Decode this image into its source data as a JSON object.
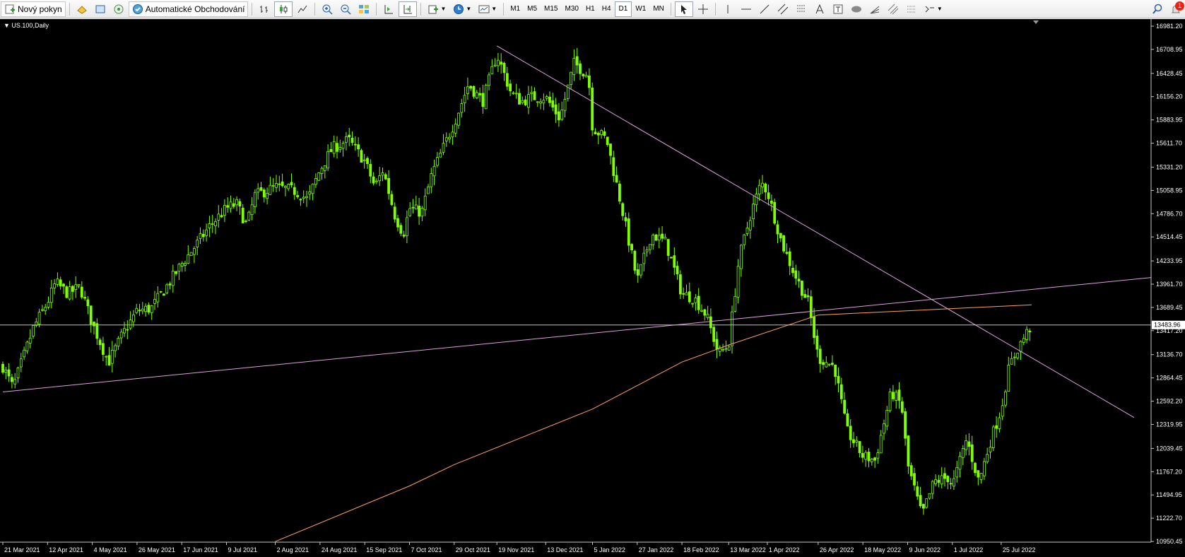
{
  "toolbar": {
    "new_order": "Nový pokyn",
    "auto_trading": "Automatické Obchodování",
    "timeframes": [
      {
        "label": "M1",
        "selected": false
      },
      {
        "label": "M5",
        "selected": false
      },
      {
        "label": "M15",
        "selected": false
      },
      {
        "label": "M30",
        "selected": false
      },
      {
        "label": "H1",
        "selected": false
      },
      {
        "label": "H4",
        "selected": false
      },
      {
        "label": "D1",
        "selected": true
      },
      {
        "label": "W1",
        "selected": false
      },
      {
        "label": "MN",
        "selected": false
      }
    ],
    "notification_count": "1",
    "icons": [
      "new-order-icon",
      "history-icon",
      "terminal-icon",
      "signals-icon",
      "auto-trading-icon",
      "bar-chart-icon",
      "candlestick-icon",
      "line-chart-icon",
      "zoom-in-icon",
      "zoom-out-icon",
      "tile-windows-icon",
      "chart-shift-icon",
      "autoscroll-icon",
      "indicators-icon",
      "periods-icon",
      "templates-icon",
      "cursor-icon",
      "crosshair-icon",
      "vertical-line-icon",
      "horizontal-line-icon",
      "trendline-icon",
      "equidistant-channel-icon",
      "fibonacci-icon",
      "text-icon",
      "text-label-icon",
      "ellipse-icon",
      "fibo-fan-icon",
      "gann-icon",
      "arrows-icon",
      "search-icon",
      "bell-icon"
    ]
  },
  "chart": {
    "symbol_label": "US.100,Daily",
    "current_price_label": "13483.96",
    "colors": {
      "background": "#000000",
      "candle": "#7fff00",
      "trendline": "#dda0dd",
      "moving_average": "#ffa062",
      "price_line": "#c0c0c0",
      "axis_text": "#ffffff"
    }
  },
  "chart_data": {
    "type": "candlestick",
    "symbol": "US.100",
    "timeframe": "Daily",
    "x_range": [
      "21 Mar 2021",
      "9 Aug 2022"
    ],
    "ylim": [
      10950.45,
      16981.2
    ],
    "y_ticks": [
      16981.2,
      16708.95,
      16428.45,
      16156.2,
      15883.95,
      15611.7,
      15331.2,
      15058.95,
      14786.7,
      14514.45,
      14233.95,
      13961.7,
      13689.45,
      13417.2,
      13136.7,
      12864.45,
      12592.2,
      12319.95,
      12039.45,
      11767.2,
      11494.95,
      11222.7,
      10950.45
    ],
    "x_ticks": [
      "21 Mar 2021",
      "12 Apr 2021",
      "4 May 2021",
      "26 May 2021",
      "17 Jun 2021",
      "9 Jul 2021",
      "2 Aug 2021",
      "24 Aug 2021",
      "15 Sep 2021",
      "7 Oct 2021",
      "29 Oct 2021",
      "19 Nov 2021",
      "13 Dec 2021",
      "5 Jan 2022",
      "27 Jan 2022",
      "18 Feb 2022",
      "13 Mar 2022",
      "1 Apr 2022",
      "26 Apr 2022",
      "18 May 2022",
      "9 Jun 2022",
      "1 Jul 2022",
      "25 Jul 2022"
    ],
    "current_price": 13483.96,
    "price_path": [
      {
        "date": "21 Mar 2021",
        "close": 13000
      },
      {
        "date": "26 Mar 2021",
        "close": 12750
      },
      {
        "date": "5 Apr 2021",
        "close": 13450
      },
      {
        "date": "12 Apr 2021",
        "close": 13750
      },
      {
        "date": "16 Apr 2021",
        "close": 13980
      },
      {
        "date": "22 Apr 2021",
        "close": 13850
      },
      {
        "date": "28 Apr 2021",
        "close": 13930
      },
      {
        "date": "4 May 2021",
        "close": 13500
      },
      {
        "date": "12 May 2021",
        "close": 13050
      },
      {
        "date": "19 May 2021",
        "close": 13380
      },
      {
        "date": "26 May 2021",
        "close": 13650
      },
      {
        "date": "2 Jun 2021",
        "close": 13680
      },
      {
        "date": "10 Jun 2021",
        "close": 13950
      },
      {
        "date": "17 Jun 2021",
        "close": 14200
      },
      {
        "date": "25 Jun 2021",
        "close": 14450
      },
      {
        "date": "1 Jul 2021",
        "close": 14650
      },
      {
        "date": "9 Jul 2021",
        "close": 14850
      },
      {
        "date": "14 Jul 2021",
        "close": 14900
      },
      {
        "date": "19 Jul 2021",
        "close": 14650
      },
      {
        "date": "23 Jul 2021",
        "close": 15000
      },
      {
        "date": "2 Aug 2021",
        "close": 15100
      },
      {
        "date": "12 Aug 2021",
        "close": 15050
      },
      {
        "date": "18 Aug 2021",
        "close": 14950
      },
      {
        "date": "24 Aug 2021",
        "close": 15300
      },
      {
        "date": "30 Aug 2021",
        "close": 15550
      },
      {
        "date": "7 Sep 2021",
        "close": 15650
      },
      {
        "date": "15 Sep 2021",
        "close": 15400
      },
      {
        "date": "20 Sep 2021",
        "close": 15100
      },
      {
        "date": "24 Sep 2021",
        "close": 15300
      },
      {
        "date": "30 Sep 2021",
        "close": 14750
      },
      {
        "date": "4 Oct 2021",
        "close": 14550
      },
      {
        "date": "7 Oct 2021",
        "close": 14850
      },
      {
        "date": "13 Oct 2021",
        "close": 14800
      },
      {
        "date": "18 Oct 2021",
        "close": 15250
      },
      {
        "date": "29 Oct 2021",
        "close": 15850
      },
      {
        "date": "5 Nov 2021",
        "close": 16300
      },
      {
        "date": "12 Nov 2021",
        "close": 16100
      },
      {
        "date": "19 Nov 2021",
        "close": 16650
      },
      {
        "date": "26 Nov 2021",
        "close": 16200
      },
      {
        "date": "1 Dec 2021",
        "close": 16100
      },
      {
        "date": "6 Dec 2021",
        "close": 16150
      },
      {
        "date": "13 Dec 2021",
        "close": 16150
      },
      {
        "date": "20 Dec 2021",
        "close": 15900
      },
      {
        "date": "27 Dec 2021",
        "close": 16550
      },
      {
        "date": "3 Jan 2022",
        "close": 16400
      },
      {
        "date": "5 Jan 2022",
        "close": 15800
      },
      {
        "date": "12 Jan 2022",
        "close": 15650
      },
      {
        "date": "19 Jan 2022",
        "close": 14900
      },
      {
        "date": "27 Jan 2022",
        "close": 14000
      },
      {
        "date": "3 Feb 2022",
        "close": 14550
      },
      {
        "date": "10 Feb 2022",
        "close": 14450
      },
      {
        "date": "18 Feb 2022",
        "close": 13850
      },
      {
        "date": "24 Feb 2022",
        "close": 13800
      },
      {
        "date": "2 Mar 2022",
        "close": 13600
      },
      {
        "date": "8 Mar 2022",
        "close": 13150
      },
      {
        "date": "13 Mar 2022",
        "close": 13250
      },
      {
        "date": "18 Mar 2022",
        "close": 14250
      },
      {
        "date": "24 Mar 2022",
        "close": 14800
      },
      {
        "date": "29 Mar 2022",
        "close": 15150
      },
      {
        "date": "1 Apr 2022",
        "close": 15050
      },
      {
        "date": "8 Apr 2022",
        "close": 14450
      },
      {
        "date": "14 Apr 2022",
        "close": 14100
      },
      {
        "date": "21 Apr 2022",
        "close": 13750
      },
      {
        "date": "26 Apr 2022",
        "close": 13100
      },
      {
        "date": "4 May 2022",
        "close": 13000
      },
      {
        "date": "10 May 2022",
        "close": 12250
      },
      {
        "date": "18 May 2022",
        "close": 11950
      },
      {
        "date": "24 May 2022",
        "close": 11900
      },
      {
        "date": "1 Jun 2022",
        "close": 12700
      },
      {
        "date": "6 Jun 2022",
        "close": 12550
      },
      {
        "date": "9 Jun 2022",
        "close": 11850
      },
      {
        "date": "16 Jun 2022",
        "close": 11250
      },
      {
        "date": "22 Jun 2022",
        "close": 11650
      },
      {
        "date": "29 Jun 2022",
        "close": 11700
      },
      {
        "date": "1 Jul 2022",
        "close": 11600
      },
      {
        "date": "8 Jul 2022",
        "close": 12150
      },
      {
        "date": "14 Jul 2022",
        "close": 11650
      },
      {
        "date": "20 Jul 2022",
        "close": 12150
      },
      {
        "date": "25 Jul 2022",
        "close": 12500
      },
      {
        "date": "29 Jul 2022",
        "close": 13000
      },
      {
        "date": "3 Aug 2022",
        "close": 13250
      },
      {
        "date": "9 Aug 2022",
        "close": 13483.96
      }
    ],
    "trendlines": [
      {
        "name": "descending",
        "from": {
          "date": "19 Nov 2021",
          "price": 16750
        },
        "to": {
          "date": "9 Aug 2022",
          "price": 13100
        }
      },
      {
        "name": "ascending",
        "from": {
          "date": "21 Mar 2021",
          "price": 12700
        },
        "to": {
          "date": "9 Aug 2022",
          "price": 13900
        }
      }
    ],
    "moving_average": [
      {
        "date": "2 Aug 2021",
        "value": 10950
      },
      {
        "date": "7 Oct 2021",
        "value": 11600
      },
      {
        "date": "29 Oct 2021",
        "value": 11850
      },
      {
        "date": "5 Jan 2022",
        "value": 12500
      },
      {
        "date": "18 Feb 2022",
        "value": 13050
      },
      {
        "date": "13 Mar 2022",
        "value": 13250
      },
      {
        "date": "26 Apr 2022",
        "value": 13600
      },
      {
        "date": "9 Aug 2022",
        "value": 13720
      }
    ]
  }
}
